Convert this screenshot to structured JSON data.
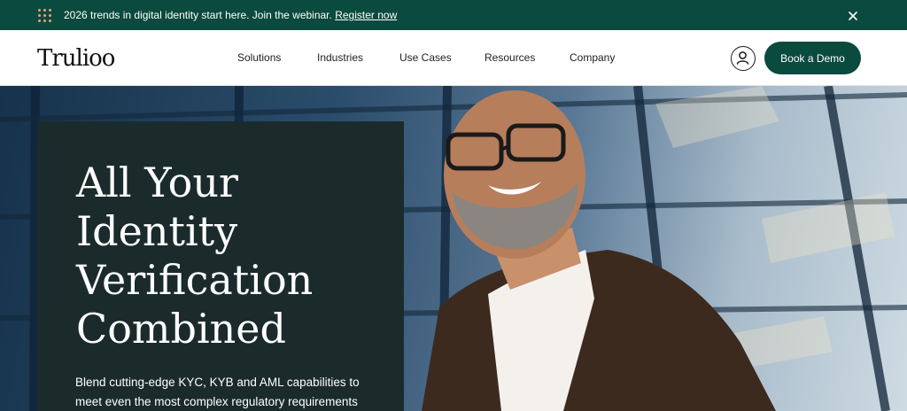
{
  "announcement": {
    "text": "2026 trends in digital identity start here. Join the webinar.",
    "link_label": "Register now",
    "dots_icon": "grid-dots-icon",
    "close_icon": "close-icon"
  },
  "header": {
    "logo": "Trulioo",
    "nav": [
      "Solutions",
      "Industries",
      "Use Cases",
      "Resources",
      "Company"
    ],
    "account_icon": "user-icon",
    "cta_label": "Book a Demo"
  },
  "hero": {
    "title": "All Your Identity Verification Combined",
    "subtitle": "Blend cutting-edge KYC, KYB and AML capabilities to meet even the most complex regulatory requirements"
  },
  "colors": {
    "brand_green": "#0b4a3e",
    "card_dark": "#1b2b2c",
    "accent_orange": "#e9a07a"
  }
}
